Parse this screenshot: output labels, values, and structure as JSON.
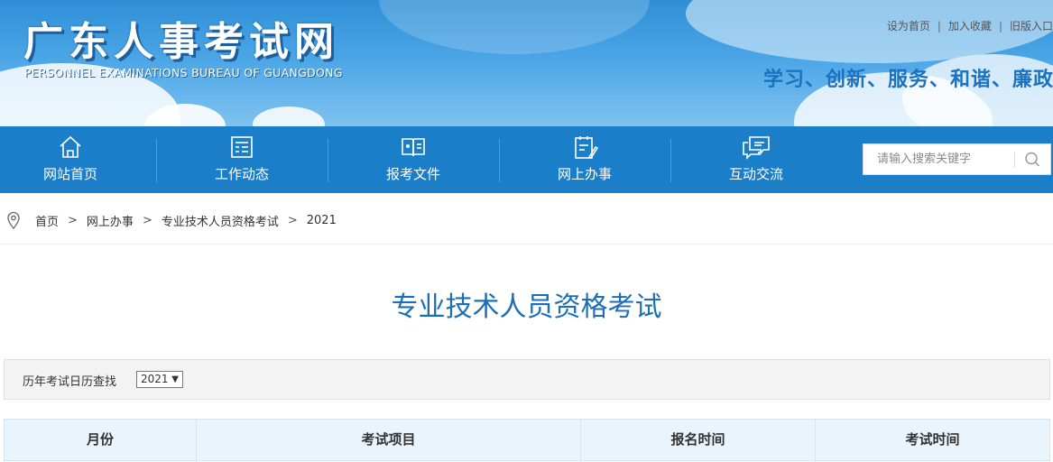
{
  "header": {
    "logo_cn": "广东人事考试网",
    "logo_en": "PERSONNEL EXAMINATIONS BUREAU OF GUANGDONG",
    "top_links": [
      "设为首页",
      "加入收藏",
      "旧版入口"
    ],
    "slogan": "学习、创新、服务、和谐、廉政"
  },
  "nav": {
    "items": [
      {
        "label": "网站首页",
        "icon": "home-icon"
      },
      {
        "label": "工作动态",
        "icon": "news-list-icon"
      },
      {
        "label": "报考文件",
        "icon": "book-icon"
      },
      {
        "label": "网上办事",
        "icon": "clipboard-pen-icon"
      },
      {
        "label": "互动交流",
        "icon": "chat-bubbles-icon"
      }
    ],
    "search_placeholder": "请输入搜索关键字"
  },
  "breadcrumb": [
    "首页",
    "网上办事",
    "专业技术人员资格考试",
    "2021"
  ],
  "page_title": "专业技术人员资格考试",
  "filter": {
    "label": "历年考试日历查找",
    "selected_year": "2021"
  },
  "table": {
    "headers": [
      "月份",
      "考试项目",
      "报名时间",
      "考试时间"
    ]
  },
  "colors": {
    "nav_bg": "#1a7ec8",
    "title": "#1d6fb5",
    "slogan": "#1d72c0"
  }
}
